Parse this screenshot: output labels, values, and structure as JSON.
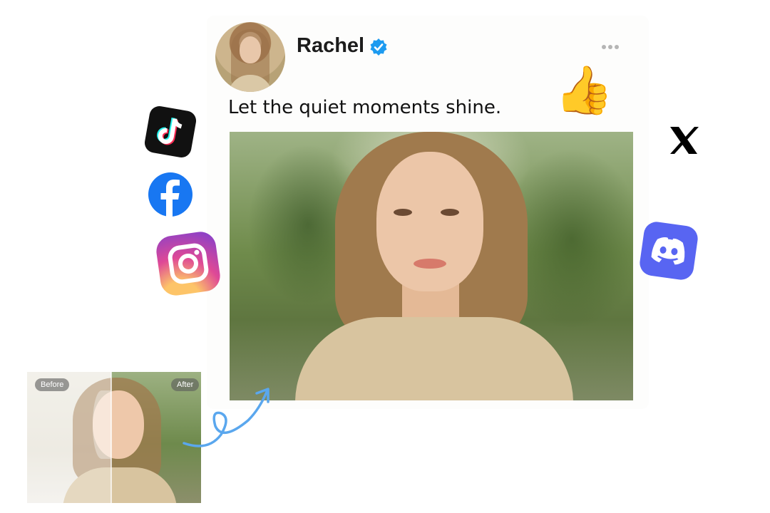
{
  "post": {
    "username": "Rachel",
    "caption": "Let the quiet moments shine.",
    "more_symbol": "•••"
  },
  "reactions": {
    "thumbs_emoji": "👍"
  },
  "social_icons": [
    "tiktok-icon",
    "facebook-icon",
    "instagram-icon",
    "x-icon",
    "discord-icon"
  ],
  "comparison": {
    "before_label": "Before",
    "after_label": "After"
  },
  "colors": {
    "verified": "#1d9bf0",
    "facebook": "#1877f2",
    "discord": "#5865f2",
    "arrow": "#5aa7ee"
  }
}
